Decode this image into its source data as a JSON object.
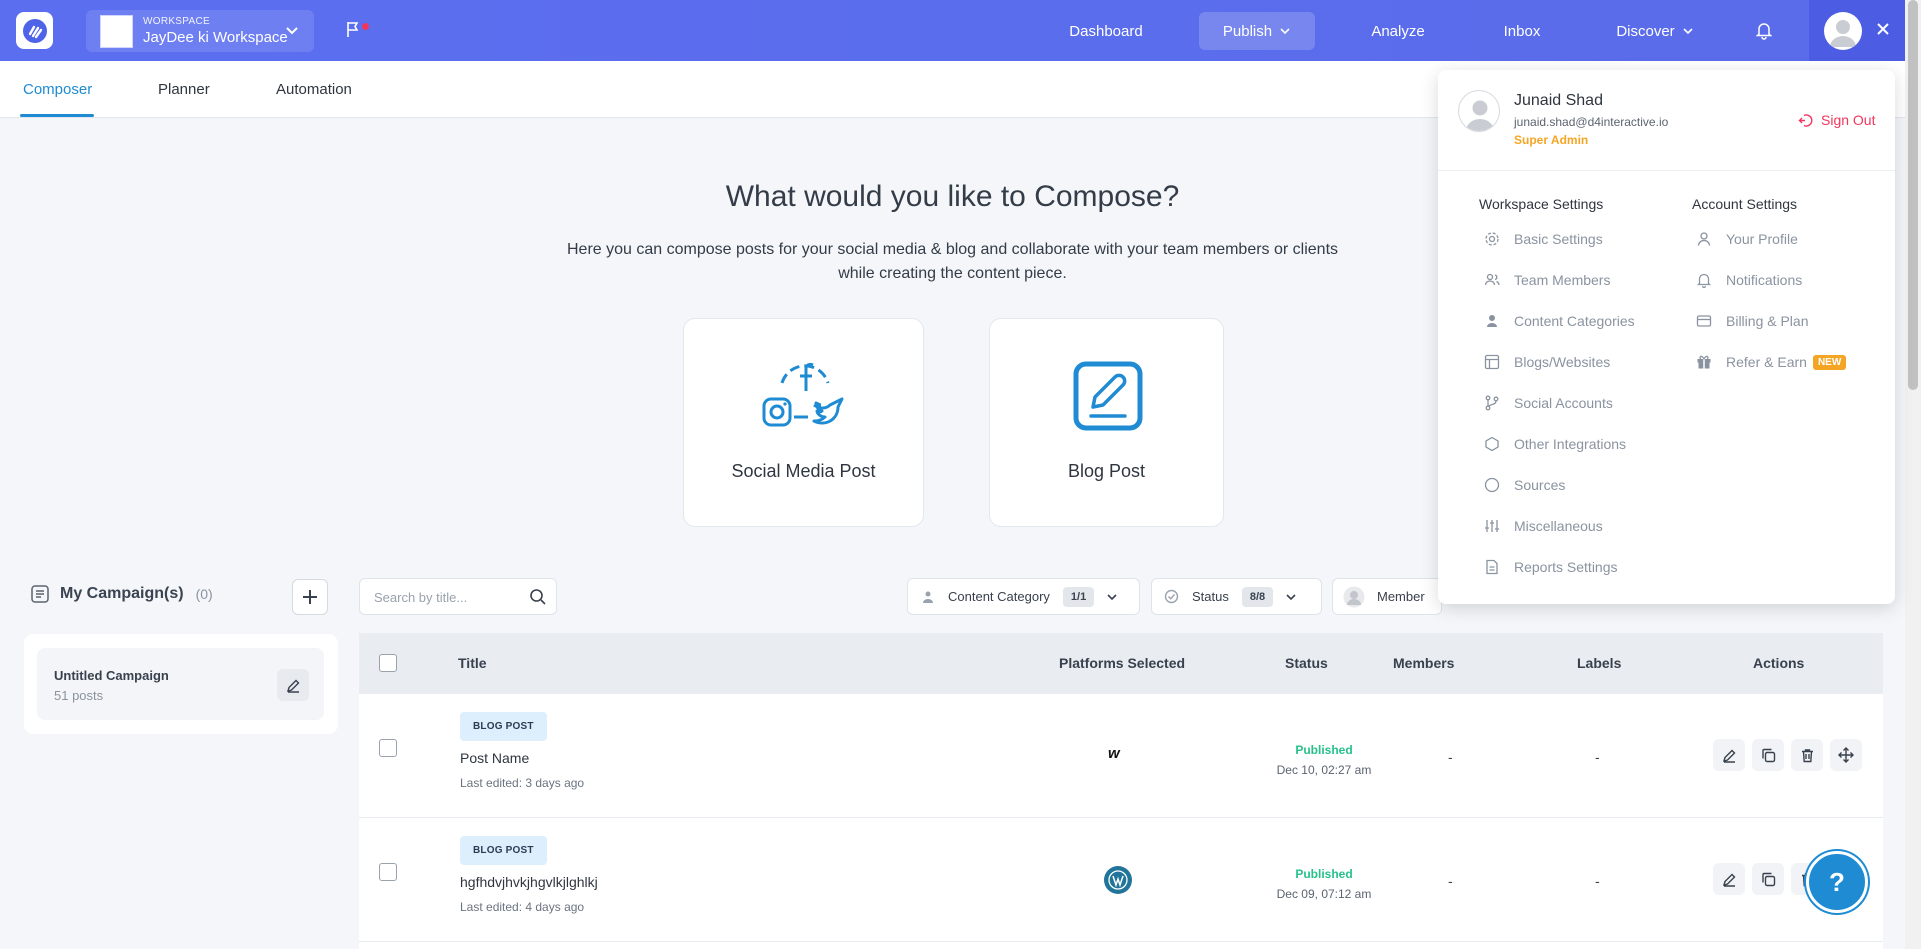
{
  "workspace": {
    "label": "WORKSPACE",
    "name": "JayDee ki Workspace"
  },
  "nav": {
    "dashboard": "Dashboard",
    "publish": "Publish",
    "analyze": "Analyze",
    "inbox": "Inbox",
    "discover": "Discover"
  },
  "tabs": {
    "composer": "Composer",
    "planner": "Planner",
    "automation": "Automation"
  },
  "hero": {
    "title": "What would you like to Compose?",
    "subtitle": "Here you can compose posts for your social media & blog and collaborate with your team members or clients while creating the content piece."
  },
  "cards": {
    "social": "Social Media Post",
    "blog": "Blog Post"
  },
  "campaigns": {
    "title": "My Campaign(s)",
    "count": "(0)",
    "item": {
      "name": "Untitled Campaign",
      "posts": "51 posts"
    }
  },
  "search": {
    "placeholder": "Search by title..."
  },
  "filters": {
    "content_category": {
      "label": "Content Category",
      "badge": "1/1"
    },
    "status": {
      "label": "Status",
      "badge": "8/8"
    },
    "member": {
      "label": "Member"
    }
  },
  "table": {
    "headers": {
      "title": "Title",
      "platforms": "Platforms Selected",
      "status": "Status",
      "members": "Members",
      "labels": "Labels",
      "actions": "Actions"
    },
    "rows": [
      {
        "tag": "BLOG POST",
        "name": "Post Name",
        "edited": "Last edited: 3 days ago",
        "platform": "w",
        "status": "Published",
        "date": "Dec 10, 02:27 am",
        "members": "-",
        "labels": "-"
      },
      {
        "tag": "BLOG POST",
        "name": "hgfhdvjhvkjhgvlkjlghlkj",
        "edited": "Last edited: 4 days ago",
        "platform": "wordpress",
        "status": "Published",
        "date": "Dec 09, 07:12 am",
        "members": "-",
        "labels": "-"
      }
    ]
  },
  "help": "?",
  "user": {
    "name": "Junaid Shad",
    "email": "junaid.shad@d4interactive.io",
    "role": "Super Admin",
    "sign_out": "Sign Out"
  },
  "workspace_settings": {
    "title": "Workspace Settings",
    "items": [
      "Basic Settings",
      "Team Members",
      "Content Categories",
      "Blogs/Websites",
      "Social Accounts",
      "Other Integrations",
      "Sources",
      "Miscellaneous",
      "Reports Settings"
    ]
  },
  "account_settings": {
    "title": "Account Settings",
    "items": [
      "Your Profile",
      "Notifications",
      "Billing & Plan",
      "Refer & Earn"
    ],
    "new_badge": "NEW"
  },
  "colors": {
    "brand": "#5b6ef0",
    "accent": "#1e8bd3",
    "published": "#27c18b",
    "signout": "#f3355d",
    "role": "#f5a524"
  }
}
